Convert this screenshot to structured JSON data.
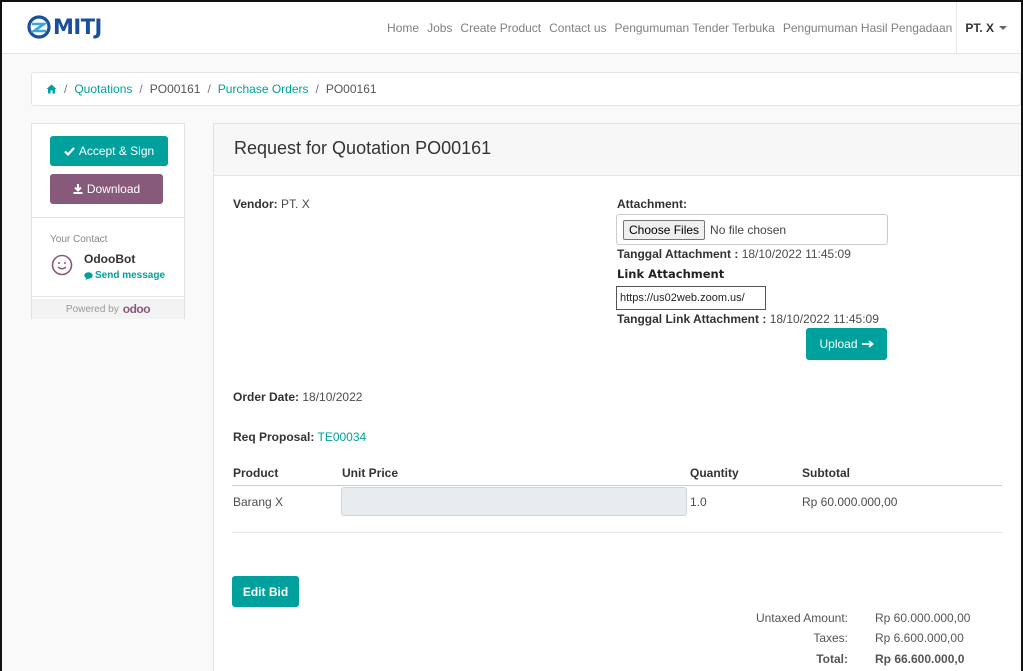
{
  "nav": {
    "logo_text": "MITJ",
    "links": [
      "Home",
      "Jobs",
      "Create Product",
      "Contact us",
      "Pengumuman Tender Terbuka",
      "Pengumuman Hasil Pengadaan"
    ],
    "user": "PT. X"
  },
  "breadcrumb": {
    "items": [
      "Quotations",
      "PO00161",
      "Purchase Orders",
      "PO00161"
    ]
  },
  "sidebar": {
    "accept_label": "Accept & Sign",
    "download_label": "Download",
    "your_contact": "Your Contact",
    "contact_name": "OdooBot",
    "send_message": "Send message",
    "powered_by": "Powered by",
    "odoo_brand": "odoo"
  },
  "main": {
    "title": "Request for Quotation PO00161",
    "vendor_label": "Vendor:",
    "vendor_value": "PT. X",
    "attachment_label": "Attachment:",
    "choose_files": "Choose Files",
    "no_file": "No file chosen",
    "tanggal_attachment_label": "Tanggal Attachment :",
    "tanggal_attachment_value": "18/10/2022 11:45:09",
    "link_attachment_label": "Link Attachment",
    "link_attachment_value": "https://us02web.zoom.us/",
    "tanggal_link_label": "Tanggal Link Attachment :",
    "tanggal_link_value": "18/10/2022 11:45:09",
    "upload_label": "Upload",
    "order_date_label": "Order Date:",
    "order_date_value": "18/10/2022",
    "req_proposal_label": "Req Proposal:",
    "req_proposal_value": "TE00034",
    "table": {
      "headers": [
        "Product",
        "Unit Price",
        "Quantity",
        "Subtotal"
      ],
      "rows": [
        {
          "product": "Barang X",
          "unit_price": "",
          "quantity": "1.0",
          "subtotal": "Rp 60.000.000,00"
        }
      ]
    },
    "edit_bid_label": "Edit Bid",
    "totals": {
      "untaxed_label": "Untaxed Amount:",
      "untaxed_value": "Rp 60.000.000,00",
      "taxes_label": "Taxes:",
      "taxes_value": "Rp 6.600.000,00",
      "total_label": "Total:",
      "total_value": "Rp 66.600.000,0"
    }
  },
  "colors": {
    "primary": "#00a09d",
    "secondary": "#875a7b",
    "logo_blue": "#1a4f9c"
  }
}
